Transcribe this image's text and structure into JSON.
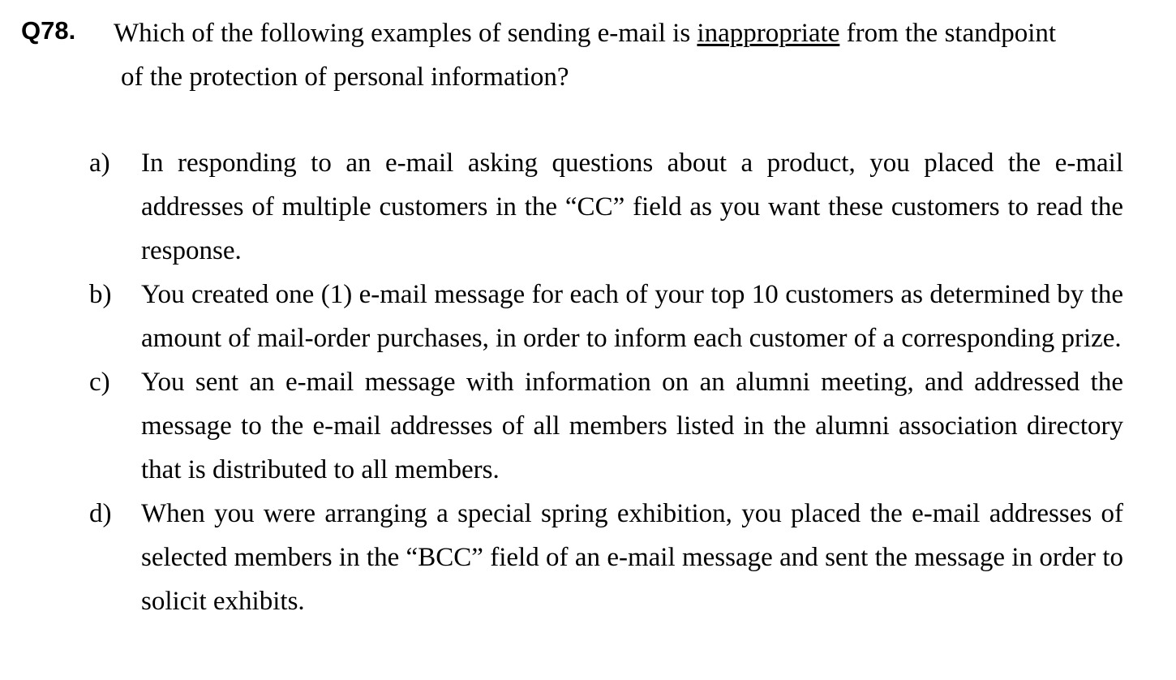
{
  "question": {
    "number": "Q78.",
    "text_before": "Which of the following examples of sending e-mail is ",
    "emphasis": "inappropriate",
    "text_after": " from the standpoint",
    "line2": "of the protection of personal information?"
  },
  "options": [
    {
      "letter": "a)",
      "text": "In responding to an e-mail asking questions about a product, you placed the e-mail addresses of multiple customers in the “CC” field as you want these customers to read the response."
    },
    {
      "letter": "b)",
      "text": "You created one (1) e-mail message for each of your top 10 customers as determined by the amount of mail-order purchases, in order to inform each customer of a corresponding prize."
    },
    {
      "letter": "c)",
      "text": "You sent an e-mail message with information on an alumni meeting, and addressed the message to the e-mail addresses of all members listed in the alumni association directory that is distributed to all members."
    },
    {
      "letter": "d)",
      "text": "When you were arranging a special spring exhibition, you placed the e-mail addresses of selected members in the “BCC” field of an e-mail message and sent the message in order to solicit exhibits."
    }
  ]
}
